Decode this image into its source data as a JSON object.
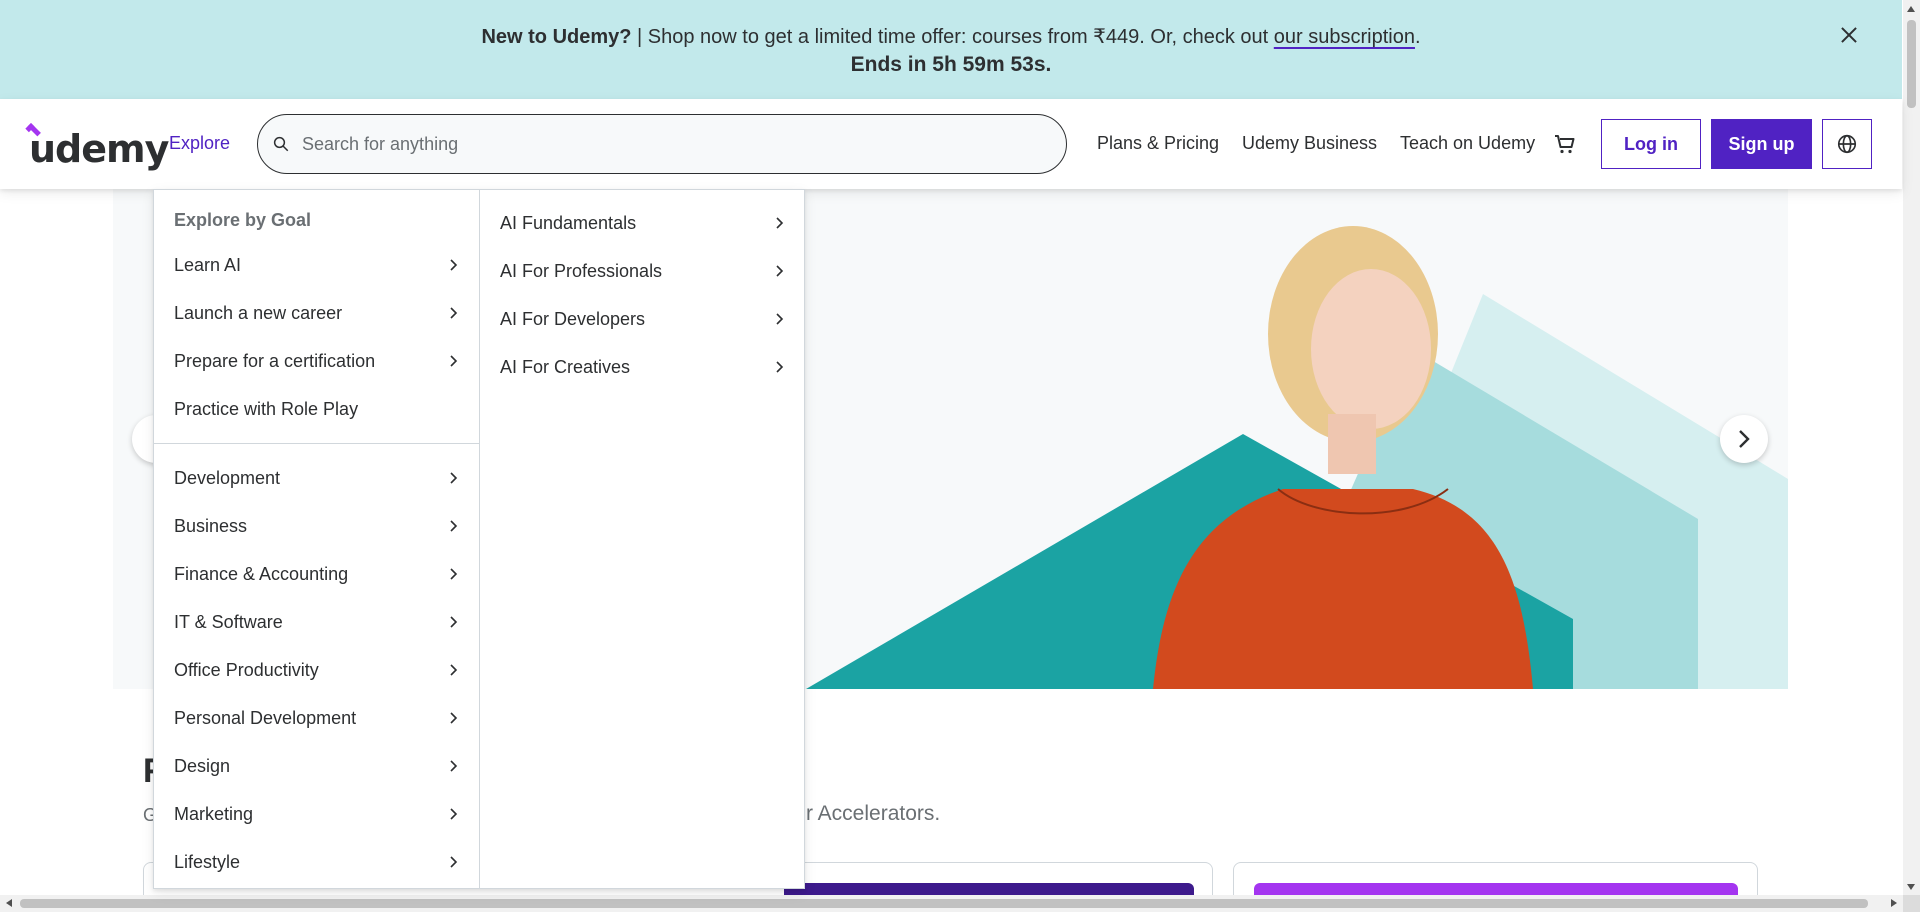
{
  "banner": {
    "bold_text": "New to Udemy?",
    "text": " | Shop now to get a limited time offer: courses from ₹449. Or, check out ",
    "link_text": "our subscription",
    "end_text": ".",
    "countdown": "Ends in 5h 59m 53s."
  },
  "header": {
    "logo_text": "udemy",
    "explore_label": "Explore",
    "search_placeholder": "Search for anything",
    "nav": {
      "plans": "Plans & Pricing",
      "business": "Udemy Business",
      "teach": "Teach on Udemy"
    },
    "login_label": "Log in",
    "signup_label": "Sign up",
    "icons": {
      "search": "search-icon",
      "cart": "cart-icon",
      "language": "globe-icon"
    }
  },
  "menu": {
    "heading": "Explore by Goal",
    "goals": [
      {
        "label": "Learn AI",
        "has_sub": true
      },
      {
        "label": "Launch a new career",
        "has_sub": true
      },
      {
        "label": "Prepare for a certification",
        "has_sub": true
      },
      {
        "label": "Practice with Role Play",
        "has_sub": false
      }
    ],
    "categories": [
      {
        "label": "Development"
      },
      {
        "label": "Business"
      },
      {
        "label": "Finance & Accounting"
      },
      {
        "label": "IT & Software"
      },
      {
        "label": "Office Productivity"
      },
      {
        "label": "Personal Development"
      },
      {
        "label": "Design"
      },
      {
        "label": "Marketing"
      },
      {
        "label": "Lifestyle"
      }
    ],
    "submenu": [
      {
        "label": "AI Fundamentals"
      },
      {
        "label": "AI For Professionals"
      },
      {
        "label": "AI For Developers"
      },
      {
        "label": "AI For Creatives"
      }
    ]
  },
  "content": {
    "section_heading_start": "F",
    "section_sub_visible": "r Accelerators.",
    "section_sub_start": "G"
  },
  "colors": {
    "brand_purple": "#5022c3",
    "logo_accent": "#a435f0",
    "banner_bg": "#c2e9eb",
    "hero_teal": "#1ba3a3"
  }
}
